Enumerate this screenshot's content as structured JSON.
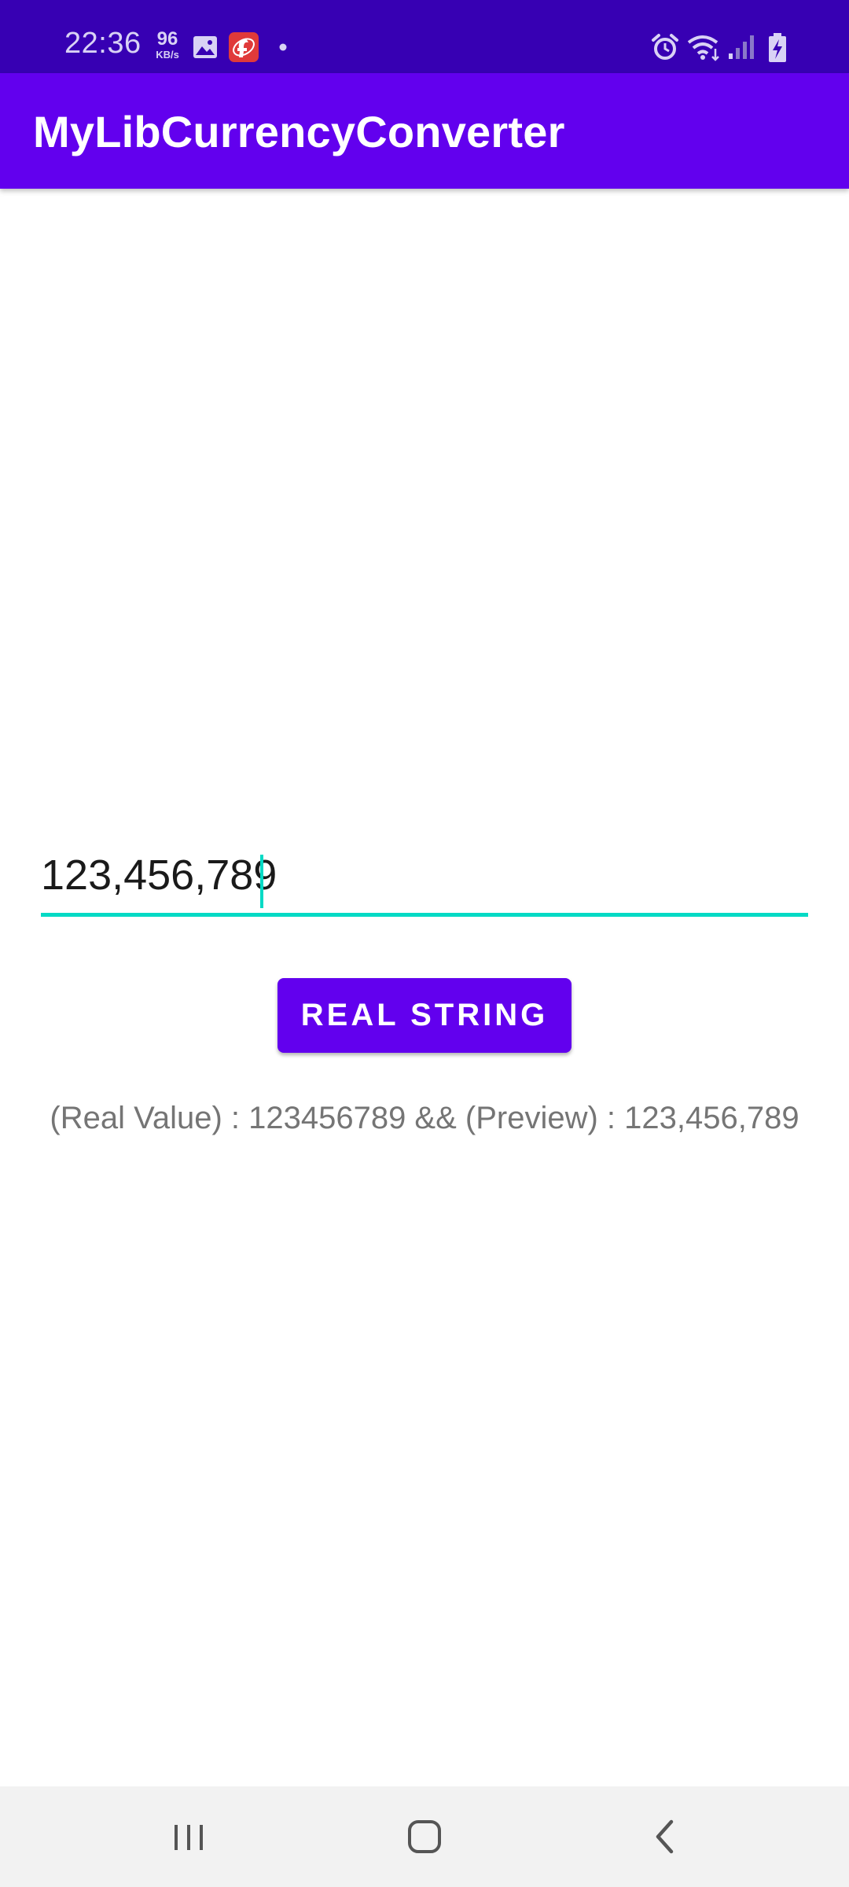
{
  "status_bar": {
    "time": "22:36",
    "net_speed": "96",
    "net_speed_unit": "KB/s"
  },
  "app_bar": {
    "title": "MyLibCurrencyConverter"
  },
  "form": {
    "amount_value": "123,456,789",
    "button_label": "REAL STRING",
    "result_text": "(Real Value) : 123456789 && (Preview) : 123,456,789"
  },
  "colors": {
    "status_bar": "#3700b3",
    "primary": "#6200ee",
    "accent": "#03dac5"
  },
  "icons": {
    "status_left": [
      "image-icon",
      "app-notification-icon",
      "dot-icon"
    ],
    "status_right": [
      "alarm-icon",
      "wifi-icon",
      "signal-icon",
      "battery-charging-icon"
    ],
    "nav": [
      "recent-apps-icon",
      "home-icon",
      "back-icon"
    ]
  }
}
